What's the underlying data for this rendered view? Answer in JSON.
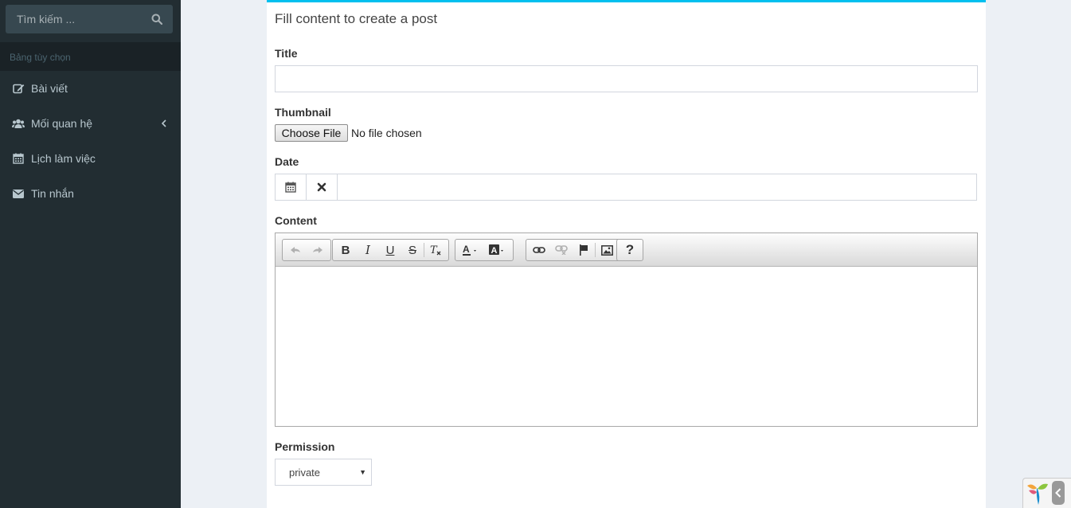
{
  "sidebar": {
    "search_placeholder": "Tìm kiếm ...",
    "header": "Bảng tùy chọn",
    "items": [
      {
        "label": "Bài viết",
        "icon": "edit-icon"
      },
      {
        "label": "Mối quan hệ",
        "icon": "users-icon",
        "has_submenu": true
      },
      {
        "label": "Lịch làm việc",
        "icon": "calendar-icon"
      },
      {
        "label": "Tin nhắn",
        "icon": "envelope-icon"
      }
    ]
  },
  "form": {
    "title": "Fill content to create a post",
    "title_label": "Title",
    "title_value": "",
    "thumbnail_label": "Thumbnail",
    "file_button": "Choose File",
    "file_status": "No file chosen",
    "date_label": "Date",
    "date_value": "",
    "content_label": "Content",
    "content_value": "",
    "permission_label": "Permission",
    "permission_value": "private"
  },
  "colors": {
    "sidebar_bg": "#222d32",
    "box_accent": "#00c0ef",
    "page_bg": "#ecf0f5"
  }
}
